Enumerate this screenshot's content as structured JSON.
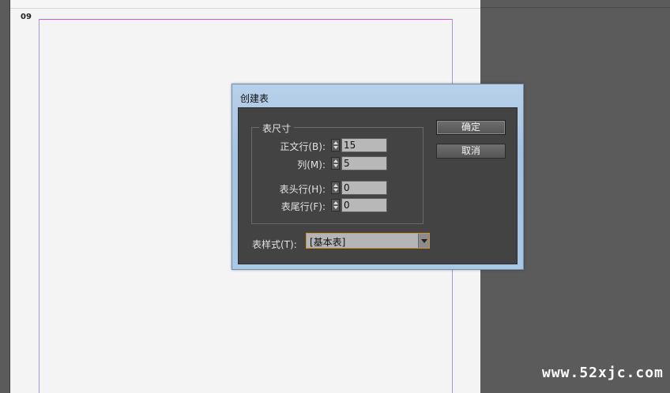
{
  "document": {
    "page_number": "09"
  },
  "dialog": {
    "title": "创建表",
    "group_label": "表尺寸",
    "fields": [
      {
        "label": "正文行(B):",
        "value": "15"
      },
      {
        "label": "列(M):",
        "value": "5"
      },
      {
        "label": "表头行(H):",
        "value": "0"
      },
      {
        "label": "表尾行(F):",
        "value": "0"
      }
    ],
    "ok_label": "确定",
    "cancel_label": "取消",
    "style_label": "表样式(T):",
    "style_value": "[基本表]"
  },
  "watermark": "www.52xjc.com",
  "colors": {
    "dialog_body": "#434343",
    "dialog_frame": "#a9c8e6",
    "margin_guide": "#d05bd0",
    "column_guide": "#a59bd8",
    "focus_border": "#d6922e"
  }
}
